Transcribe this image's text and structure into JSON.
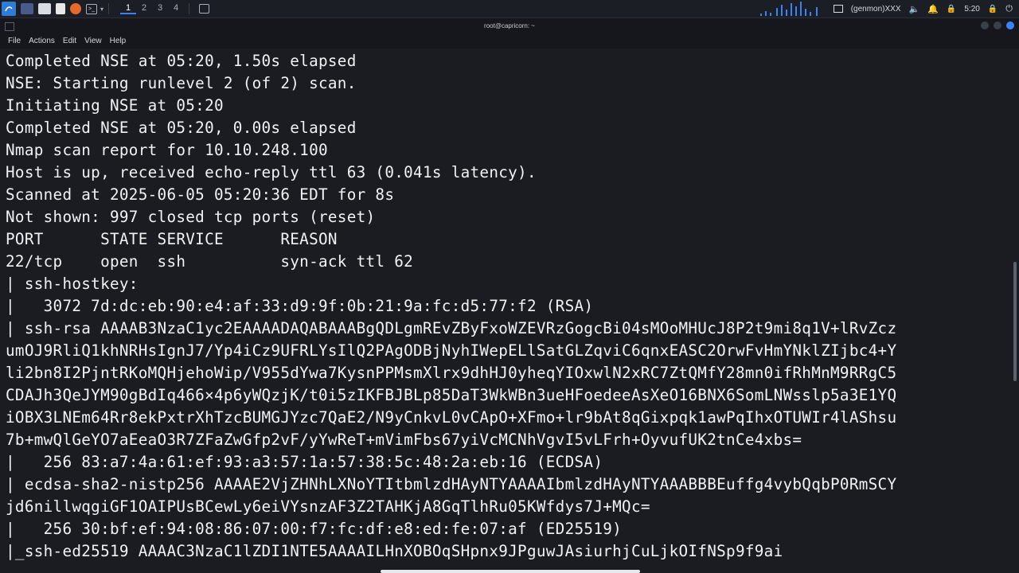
{
  "panel": {
    "workspaces": [
      "1",
      "2",
      "3",
      "4"
    ],
    "active_workspace": "1",
    "genmon_label": "(genmon)XXX",
    "clock": "5:20",
    "icons": [
      "kali-menu-icon",
      "desktop-icon",
      "files-icon",
      "text-editor-icon",
      "firefox-icon",
      "terminal-icon",
      "terminal-window-icon",
      "volume-icon",
      "bell-icon",
      "lock-icon",
      "power-icon"
    ]
  },
  "window": {
    "title": "root@capricorn: ~"
  },
  "menu": {
    "items": [
      "File",
      "Actions",
      "Edit",
      "View",
      "Help"
    ]
  },
  "terminal": {
    "lines": [
      "Completed NSE at 05:20, 1.50s elapsed",
      "NSE: Starting runlevel 2 (of 2) scan.",
      "Initiating NSE at 05:20",
      "Completed NSE at 05:20, 0.00s elapsed",
      "Nmap scan report for 10.10.248.100",
      "Host is up, received echo-reply ttl 63 (0.041s latency).",
      "Scanned at 2025-06-05 05:20:36 EDT for 8s",
      "Not shown: 997 closed tcp ports (reset)",
      "PORT      STATE SERVICE      REASON",
      "22/tcp    open  ssh          syn-ack ttl 62",
      "| ssh-hostkey:",
      "|   3072 7d:dc:eb:90:e4:af:33:d9:9f:0b:21:9a:fc:d5:77:f2 (RSA)",
      "| ssh-rsa AAAAB3NzaC1yc2EAAAADAQABAAABgQDLgmREvZByFxoWZEVRzGogcBi04sMOoMHUcJ8P2t9mi8q1V+lRvZcz",
      "umOJ9RliQ1khNRHsIgnJ7/Yp4iCz9UFRLYsIlQ2PAgODBjNyhIWepELlSatGLZqviC6qnxEASC2OrwFvHmYNklZIjbc4+Y",
      "li2bn8I2PjntRKoMQHjehoWip/V955dYwa7KysnPPMsmXlrx9dhHJ0yheqYIOxwlN2xRC7ZtQMfY28mn0ifRhMnM9RRgC5",
      "CDAJh3QeJYM90gBdIq466×4p6yWQzjK/t0i5zIKFBJBLp85DaT3WkWBn3ueHFoedeeAsXeO16BNX6SomLNWsslp5a3E1YQ",
      "iOBX3LNEm64Rr8ekPxtrXhTzcBUMGJYzc7QaE2/N9yCnkvL0vCApO+XFmo+lr9bAt8qGixpqk1awPqIhxOTUWIr4lAShsu",
      "7b+mwQlGeYO7aEeaO3R7ZFaZwGfp2vF/yYwReT+mVimFbs67yiVcMCNhVgvI5vLFrh+OyvufUK2tnCe4xbs=",
      "|   256 83:a7:4a:61:ef:93:a3:57:1a:57:38:5c:48:2a:eb:16 (ECDSA)",
      "| ecdsa-sha2-nistp256 AAAAE2VjZHNhLXNoYTItbmlzdHAyNTYAAAAIbmlzdHAyNTYAAABBBEuffg4vybQqbP0RmSCY",
      "jd6nillwqgiGF1OAIPUsBCewLy6eiVYsnzAF3Z2TAHKjA8GqTlhRu05KWfdys7J+MQc=",
      "|   256 30:bf:ef:94:08:86:07:00:f7:fc:df:e8:ed:fe:07:af (ED25519)",
      "|_ssh-ed25519 AAAAC3NzaC1lZDI1NTE5AAAAILHnXOBOqSHpnx9JPguwJAsiurhjCuLjkOIfNSp9f9ai"
    ]
  }
}
